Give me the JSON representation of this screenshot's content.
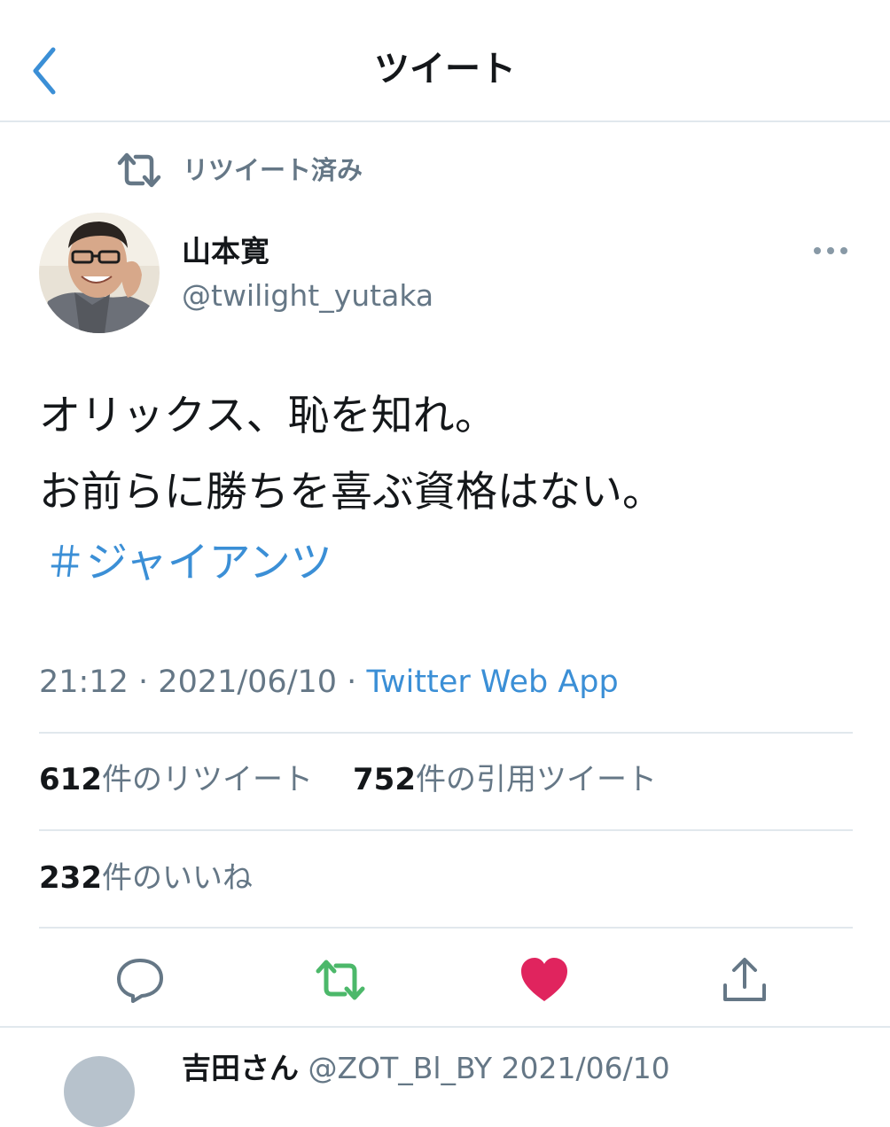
{
  "header": {
    "title": "ツイート"
  },
  "retweet_context": {
    "label": "リツイート済み"
  },
  "author": {
    "name": "山本寛",
    "handle": "@twilight_yutaka"
  },
  "tweet": {
    "lines": [
      "オリックス、恥を知れ。",
      "お前らに勝ちを喜ぶ資格はない。"
    ],
    "hashtag": "＃ジャイアンツ"
  },
  "meta": {
    "time": "21:12",
    "separator": "·",
    "date": "2021/06/10",
    "source": "Twitter Web App"
  },
  "stats": {
    "retweets": {
      "count": "612",
      "label": "件のリツイート"
    },
    "quotes": {
      "count": "752",
      "label": "件の引用ツイート"
    },
    "likes": {
      "count": "232",
      "label": "件のいいね"
    }
  },
  "actions": {
    "reply_icon": "reply-icon",
    "retweet_icon": "retweet-icon",
    "like_icon": "heart-icon",
    "share_icon": "share-icon",
    "liked": true
  },
  "next_reply": {
    "name": "吉田さん",
    "handle": "@ZOT_Bl_BY",
    "date": "2021/06/10"
  },
  "colors": {
    "accent": "#3b8fd6",
    "muted": "#657786",
    "retweet_green": "#4cb86a",
    "like_red": "#e0245e",
    "divider": "#e1e8ed"
  }
}
